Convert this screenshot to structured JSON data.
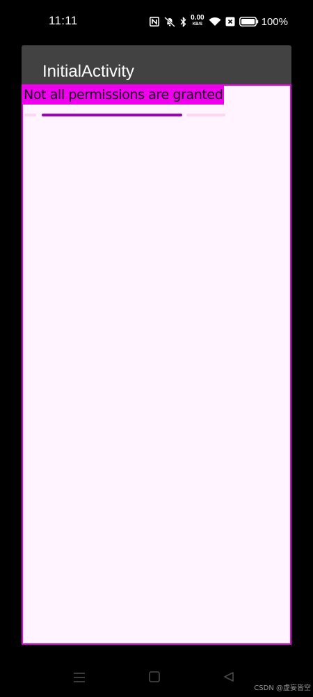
{
  "status_bar": {
    "time": "11:11",
    "net_speed_value": "0.00",
    "net_speed_unit": "KB/S",
    "battery_percent": "100%",
    "icons": [
      "nfc-icon",
      "mute-icon",
      "bluetooth-icon",
      "net-speed-indicator",
      "wifi-icon",
      "sim-none-icon",
      "battery-icon"
    ]
  },
  "app_bar": {
    "title": "InitialActivity"
  },
  "content": {
    "message": "Not all permissions are granted",
    "progress": {
      "type": "indeterminate"
    }
  },
  "nav_bar": {
    "buttons": [
      "menu",
      "home",
      "back"
    ]
  },
  "watermark": "CSDN @虚妄皆空",
  "colors": {
    "app_bar": "#424242",
    "content_background": "#fff4ff",
    "accent": "#ee00ee",
    "progress_active": "#a000b8",
    "progress_track": "#ffd6f0"
  }
}
